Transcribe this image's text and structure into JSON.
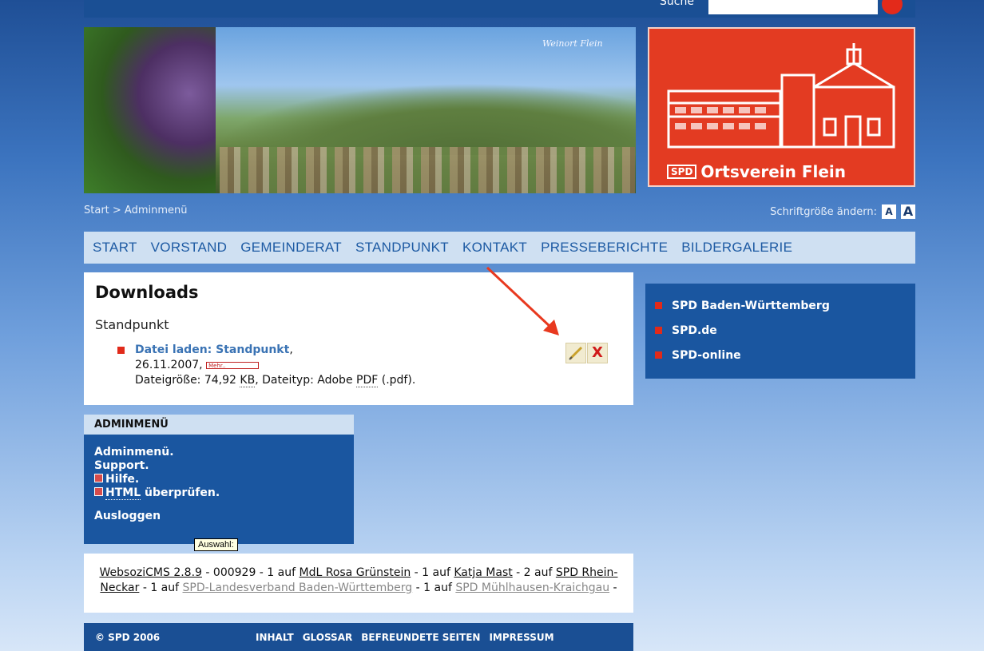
{
  "search": {
    "label": "Suche",
    "value": ""
  },
  "header": {
    "image_caption": "Weinort Flein",
    "logo_text": "Ortsverein Flein",
    "logo_badge": "SPD"
  },
  "breadcrumb": "Start > Adminmenü",
  "fontsize": {
    "label": "Schriftgröße ändern:",
    "small": "A",
    "large": "A"
  },
  "nav": [
    "START",
    "VORSTAND",
    "GEMEINDERAT",
    "STANDPUNKT",
    "KONTAKT",
    "PRESSEBERICHTE",
    "BILDERGALERIE"
  ],
  "downloads": {
    "title": "Downloads",
    "section": "Standpunkt",
    "item": {
      "link": "Datei laden: Standpunkt",
      "comma": ",",
      "date": "26.11.2007,",
      "mehr": "Mehr..",
      "size_prefix": "Dateigröße: 74,92 ",
      "size_unit": "KB",
      "type_prefix": ", Dateityp: Adobe ",
      "type_abbr": "PDF",
      "type_suffix": " (.pdf)."
    },
    "delete_glyph": "X"
  },
  "links": [
    "SPD Baden-Württemberg",
    "SPD.de",
    "SPD-online"
  ],
  "admin": {
    "title": "ADMINMENÜ",
    "items": [
      "Adminmenü.",
      "Support."
    ],
    "hilfe": "Hilfe.",
    "html_abbr": "HTML",
    "check": " überprüfen.",
    "logout": "Ausloggen",
    "tooltip": "Auswahl:"
  },
  "footer": {
    "cms": "WebsoziCMS 2.8.9",
    "t1": " - 000929 - 1 auf ",
    "l1": "MdL Rosa Grünstein",
    "t2": " - 1 auf ",
    "l2": "Katja Mast",
    "t3": " - 2 auf ",
    "l3": "SPD Rhein-Neckar",
    "t4": " - 1 auf ",
    "l4": "SPD-Landesverband Baden-Württemberg",
    "t5": " - 1 auf ",
    "l5": "SPD Mühlhausen-Kraichgau",
    "t6": " -",
    "copyright": "© SPD 2006",
    "links": [
      "INHALT",
      "GLOSSAR",
      "BEFREUNDETE SEITEN",
      "IMPRESSUM"
    ]
  },
  "colors": {
    "accent_red": "#e12a1a",
    "dark_blue": "#1a56a0",
    "nav_bg": "#cfe0f2"
  }
}
